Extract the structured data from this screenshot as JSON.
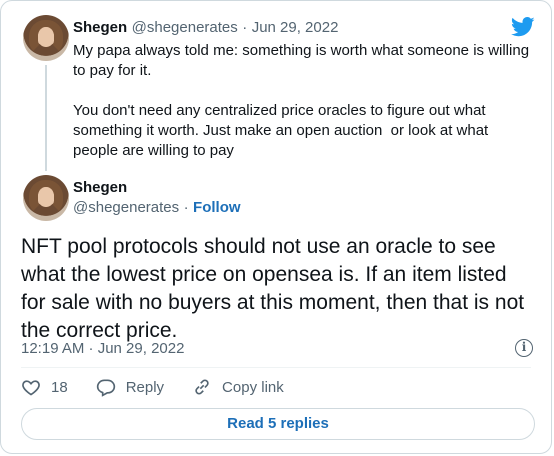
{
  "quoted_tweet": {
    "name": "Shegen",
    "handle": "@shegenerates",
    "separator": "·",
    "date": "Jun 29, 2022",
    "text": "My papa always told me: something is worth what someone is willing\nto pay for it.\n\nYou don't need any centralized price oracles to figure out what\nsomething it worth. Just make an open auction  or look at what\npeople are willing to pay"
  },
  "main_tweet": {
    "name": "Shegen",
    "handle": "@shegenerates",
    "separator": "·",
    "follow_label": "Follow",
    "text": "NFT pool protocols should not use an oracle to see what the lowest price on opensea is. If an item listed for sale with no buyers at this moment, then that is not the correct price.",
    "timestamp": "12:19 AM · Jun 29, 2022"
  },
  "actions": {
    "like_count": "18",
    "reply_label": "Reply",
    "copy_label": "Copy link"
  },
  "read_replies_label": "Read 5 replies",
  "icons": {
    "brand": "twitter-bird-icon",
    "info": "info-icon",
    "like": "heart-icon",
    "reply": "reply-icon",
    "copy": "link-icon"
  },
  "colors": {
    "accent": "#1d9bf0",
    "link": "#1d6fb8",
    "muted": "#536471",
    "border": "#cfd9de"
  }
}
